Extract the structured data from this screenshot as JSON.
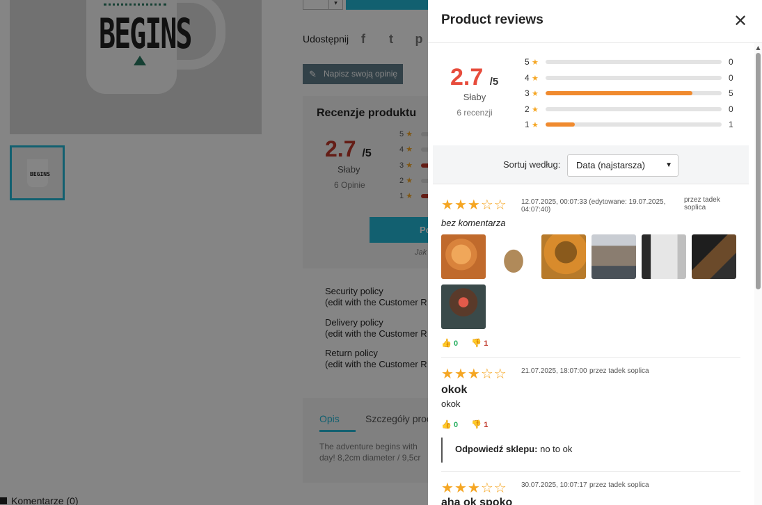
{
  "background": {
    "main_image": {
      "mug_text": "BEGINS"
    },
    "thumbnail": {
      "mug_text": "BEGINS"
    },
    "share": {
      "label": "Udostępnij",
      "icons": [
        "facebook-icon",
        "twitter-icon",
        "pinterest-icon"
      ],
      "glyphs": [
        "f",
        "t",
        "p"
      ]
    },
    "write_review_label": "Napisz swoją opinię",
    "reviews_box": {
      "title": "Recenzje produktu",
      "average": "2.7",
      "out_of": "/5",
      "rating_word": "Słaby",
      "count_label": "6 Opinie",
      "rows": [
        {
          "label": "5"
        },
        {
          "label": "4"
        },
        {
          "label": "3"
        },
        {
          "label": "2"
        },
        {
          "label": "1"
        }
      ],
      "cta_label": "Po",
      "link_text": "Jak"
    },
    "policies": [
      {
        "title": "Security policy",
        "note": "(edit with the Customer R"
      },
      {
        "title": "Delivery policy",
        "note": "(edit with the Customer R"
      },
      {
        "title": "Return policy",
        "note": "(edit with the Customer R"
      }
    ],
    "tabs": [
      "Opis",
      "Szczegóły proc"
    ],
    "description_line1": "The adventure begins with",
    "description_line2": "day! 8,2cm diameter / 9,5cr",
    "comments_label": "Komentarze (0)"
  },
  "panel": {
    "title": "Product reviews",
    "close_label": "✕",
    "summary": {
      "average": "2.7",
      "out_of": "/5",
      "rating_word": "Słaby",
      "count_label": "6 recenzji"
    },
    "distribution": [
      {
        "stars": "5",
        "count": "0",
        "fraction": 0
      },
      {
        "stars": "4",
        "count": "0",
        "fraction": 0
      },
      {
        "stars": "3",
        "count": "5",
        "fraction": 0.833
      },
      {
        "stars": "2",
        "count": "0",
        "fraction": 0
      },
      {
        "stars": "1",
        "count": "1",
        "fraction": 0.167
      }
    ],
    "sort": {
      "label": "Sortuj według:",
      "selected": "Data (najstarsza)"
    },
    "reviews": [
      {
        "rating": 3,
        "date": "12.07.2025, 00:07:33 (edytowane: 19.07.2025, 04:07:40)",
        "author": "przez tadek soplica",
        "title": "",
        "body": "bez komentarza",
        "photos": [
          "cat-photo",
          "bengal-cat-photo",
          "tree-photo",
          "canal-houses-photo",
          "cafe-photo",
          "restaurant-photo",
          "cupcake-photo"
        ],
        "helpful_yes": "0",
        "helpful_no": "1"
      },
      {
        "rating": 3,
        "date": "21.07.2025, 18:07:00",
        "author": "przez tadek soplica",
        "title": "okok",
        "body": "okok",
        "helpful_yes": "0",
        "helpful_no": "1",
        "shop_reply_label": "Odpowiedź sklepu:",
        "shop_reply": "no to ok"
      },
      {
        "rating": 3,
        "date": "30.07.2025, 10:07:17",
        "author": "przez tadek soplica",
        "title": "aha ok spoko"
      }
    ]
  }
}
